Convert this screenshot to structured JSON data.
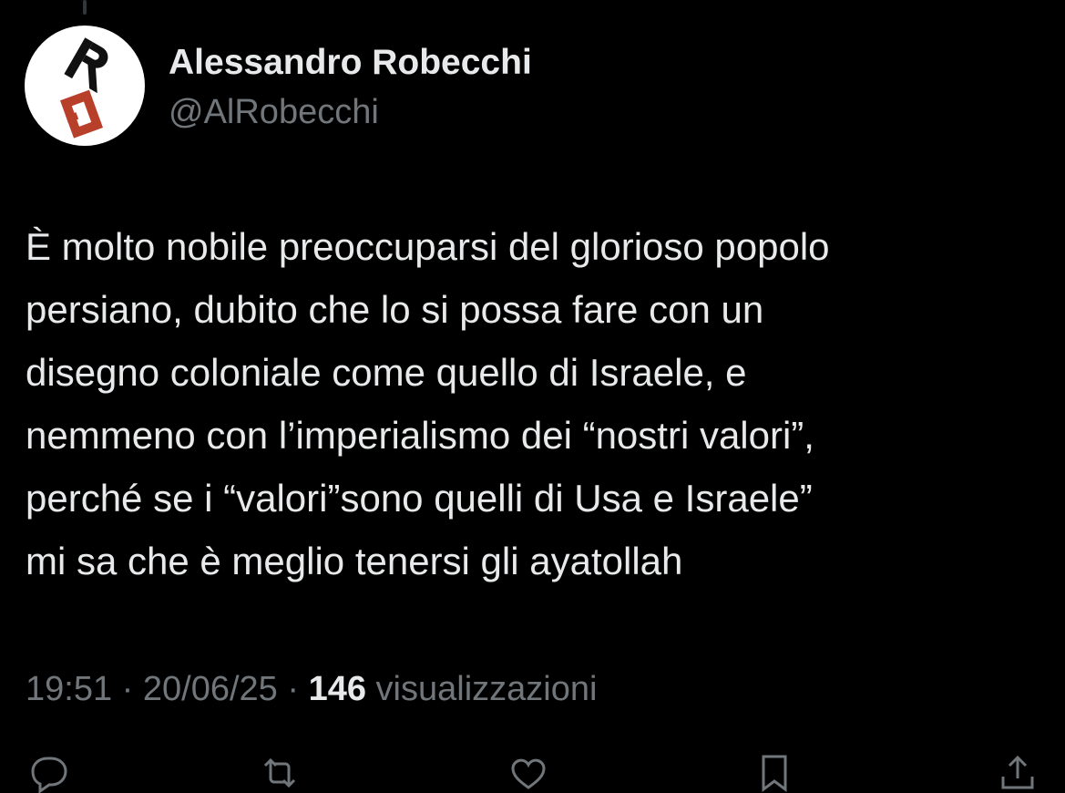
{
  "author": {
    "display_name": "Alessandro Robecchi",
    "handle": "@AlRobecchi",
    "avatar_icon": "ra-logo-avatar",
    "avatar_colors": {
      "background": "#ffffff",
      "dark": "#111111",
      "accent": "#b8402a"
    }
  },
  "tweet": {
    "lines": [
      "È molto nobile preoccuparsi del glorioso popolo",
      "persiano, dubito che lo si possa fare con un",
      "disegno coloniale come quello di Israele, e",
      "nemmeno con l’imperialismo dei “nostri valori”,",
      "perché se i “valori”sono quelli di Usa e Israele”",
      "mi sa che è meglio tenersi gli ayatollah"
    ]
  },
  "meta": {
    "time": "19:51",
    "separator": " · ",
    "date": "20/06/25",
    "views_count": "146",
    "views_label": "visualizzazioni"
  },
  "actions": [
    {
      "name": "reply",
      "icon": "reply-icon"
    },
    {
      "name": "repost",
      "icon": "repost-icon"
    },
    {
      "name": "like",
      "icon": "heart-icon"
    },
    {
      "name": "bookmark",
      "icon": "bookmark-icon"
    },
    {
      "name": "share",
      "icon": "share-icon"
    }
  ],
  "colors": {
    "background": "#000000",
    "text_primary": "#e7e9ea",
    "text_secondary": "#71767b",
    "divider": "#333639"
  }
}
